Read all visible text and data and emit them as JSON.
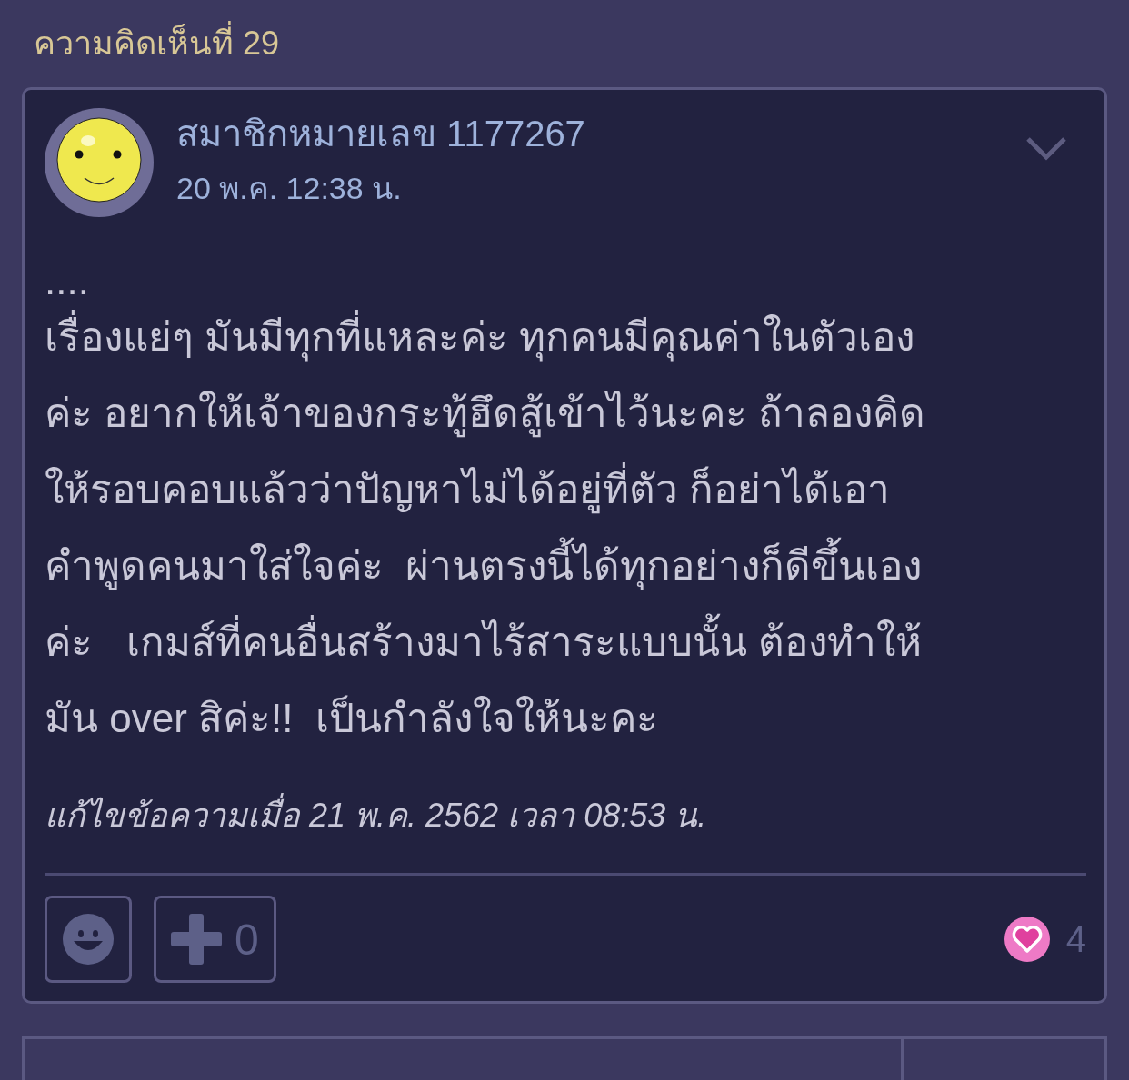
{
  "heading": "ความคิดเห็นที่ 29",
  "comment": {
    "author": "สมาชิกหมายเลข 1177267",
    "time": "20 พ.ค. 12:38 น.",
    "lines": [
      "....",
      "เรื่องแย่ๆ มันมีทุกที่แหละค่ะ ทุกคนมีคุณค่าในตัวเอง",
      "ค่ะ อยากให้เจ้าของกระทู้ฮึดสู้เข้าไว้นะคะ ถ้าลองคิด",
      "ให้รอบคอบแล้วว่าปัญหาไม่ได้อยู่ที่ตัว ก็อย่าได้เอา",
      "คำพูดคนมาใส่ใจค่ะ  ผ่านตรงนี้ได้ทุกอย่างก็ดีขึ้นเอง",
      "ค่ะ   เกมส์ที่คนอื่นสร้างมาไร้สาระแบบนั้น ต้องทำให้",
      "มัน over สิค่ะ!!  เป็นกำลังใจให้นะคะ"
    ],
    "edited": "แก้ไขข้อความเมื่อ 21 พ.ค. 2562 เวลา 08:53 น.",
    "plus_count": "0",
    "like_count": "4"
  }
}
